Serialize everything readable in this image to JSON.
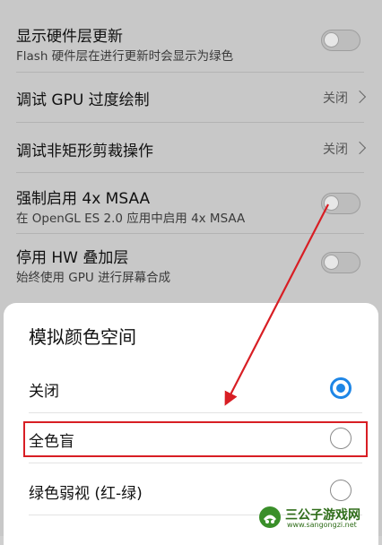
{
  "settings": {
    "rows": [
      {
        "title": "显示硬件层更新",
        "subtitle": "Flash 硬件层在进行更新时会显示为绿色",
        "control": "toggle-off"
      },
      {
        "title": "调试 GPU 过度绘制",
        "value": "关闭",
        "control": "chevron"
      },
      {
        "title": "调试非矩形剪裁操作",
        "value": "关闭",
        "control": "chevron"
      },
      {
        "title": "强制启用 4x MSAA",
        "subtitle": "在 OpenGL ES 2.0 应用中启用 4x MSAA",
        "control": "toggle-off"
      },
      {
        "title": "停用 HW 叠加层",
        "subtitle": "始终使用 GPU 进行屏幕合成",
        "control": "toggle-off"
      }
    ]
  },
  "dialog": {
    "title": "模拟颜色空间",
    "options": [
      {
        "label": "关闭",
        "selected": true
      },
      {
        "label": "全色盲",
        "selected": false,
        "highlighted": true
      },
      {
        "label": "绿色弱视 (红-绿)",
        "selected": false
      }
    ]
  },
  "annotation": {
    "arrow_color": "#d81e24",
    "highlight_color": "#d81e24"
  },
  "accent_color": "#1e86e6",
  "watermark": {
    "name": "三公子游戏网",
    "url": "www.sangongzi.net"
  }
}
